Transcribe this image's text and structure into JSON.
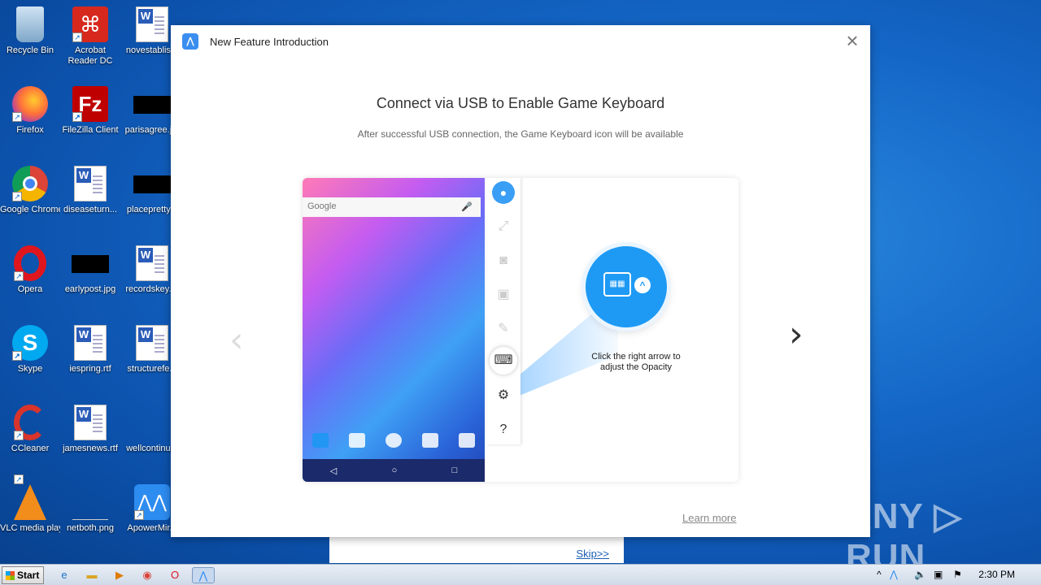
{
  "desktop": {
    "icons": [
      {
        "label": "Recycle Bin"
      },
      {
        "label": "Acrobat Reader DC"
      },
      {
        "label": "novestablis..."
      },
      {
        "label": "Firefox"
      },
      {
        "label": "FileZilla Client"
      },
      {
        "label": "parisagree.j..."
      },
      {
        "label": "Google Chrome"
      },
      {
        "label": "diseaseturn..."
      },
      {
        "label": "placepretty..."
      },
      {
        "label": "Opera"
      },
      {
        "label": "earlypost.jpg"
      },
      {
        "label": "recordskey...."
      },
      {
        "label": "Skype"
      },
      {
        "label": "iespring.rtf"
      },
      {
        "label": "structurefe..."
      },
      {
        "label": "CCleaner"
      },
      {
        "label": "jamesnews.rtf"
      },
      {
        "label": "wellcontinu..."
      },
      {
        "label": "VLC media player"
      },
      {
        "label": "netboth.png"
      },
      {
        "label": "ApowerMir..."
      }
    ]
  },
  "dialog": {
    "title": "New Feature Introduction",
    "close": "×",
    "heading": "Connect via USB to Enable Game Keyboard",
    "subheading": "After successful USB connection, the Game Keyboard icon will be available",
    "prev_arrow": "‹",
    "next_arrow": "›",
    "learn_more": "Learn more",
    "illustration": {
      "search_brand": "Google",
      "hint": "Click the right arrow to adjust the Opacity"
    }
  },
  "underlay": {
    "skip": "Skip>>"
  },
  "watermark": "ANY ▷ RUN",
  "taskbar": {
    "start": "Start",
    "clock": "2:30 PM"
  }
}
